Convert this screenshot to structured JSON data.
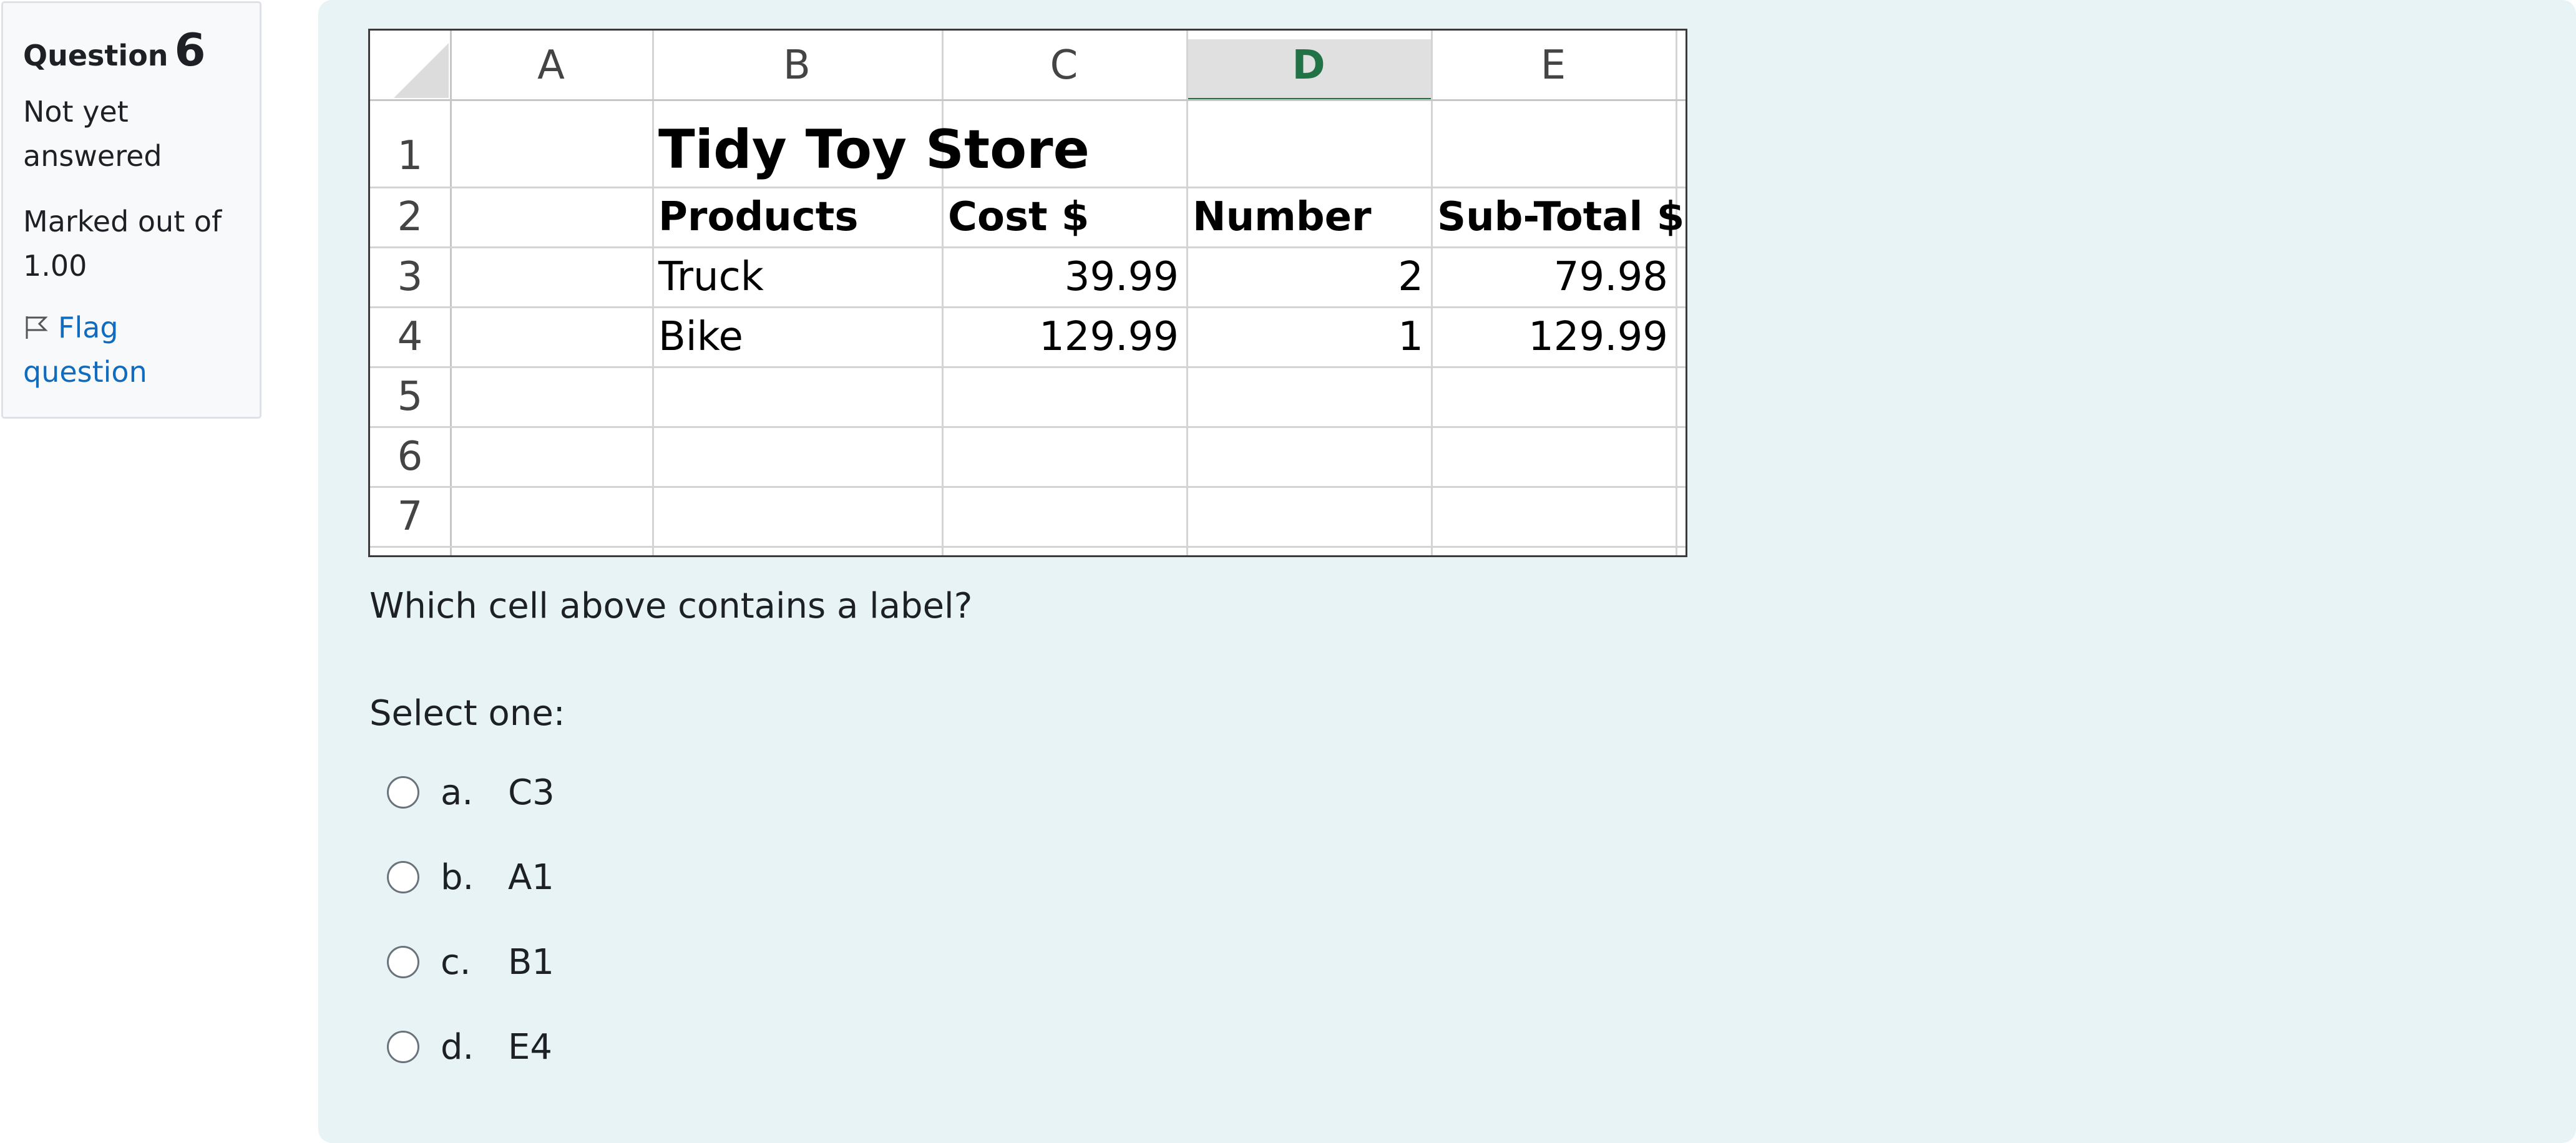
{
  "info": {
    "question_word": "Question",
    "question_number": "6",
    "state": "Not yet answered",
    "grade": "Marked out of 1.00",
    "flag_label": "Flag question"
  },
  "spreadsheet": {
    "columns": [
      "A",
      "B",
      "C",
      "D",
      "E"
    ],
    "selected_column": "D",
    "rows": [
      "1",
      "2",
      "3",
      "4",
      "5",
      "6",
      "7"
    ],
    "title": "Tidy Toy Store",
    "headers": [
      "Products",
      "Cost $",
      "Number",
      "Sub-Total $"
    ],
    "data": [
      [
        "Truck",
        "39.99",
        "2",
        "79.98"
      ],
      [
        "Bike",
        "129.99",
        "1",
        "129.99"
      ]
    ]
  },
  "question_text": "Which cell above contains a label?",
  "select_prompt": "Select one:",
  "options": [
    {
      "letter": "a.",
      "text": "C3"
    },
    {
      "letter": "b.",
      "text": "A1"
    },
    {
      "letter": "c.",
      "text": "B1"
    },
    {
      "letter": "d.",
      "text": "E4"
    }
  ],
  "colors": {
    "panel_bg": "#e7f3f5",
    "link": "#0f6cbf",
    "selected_column_text": "#217346",
    "selected_column_bg": "#e0e0e0"
  }
}
